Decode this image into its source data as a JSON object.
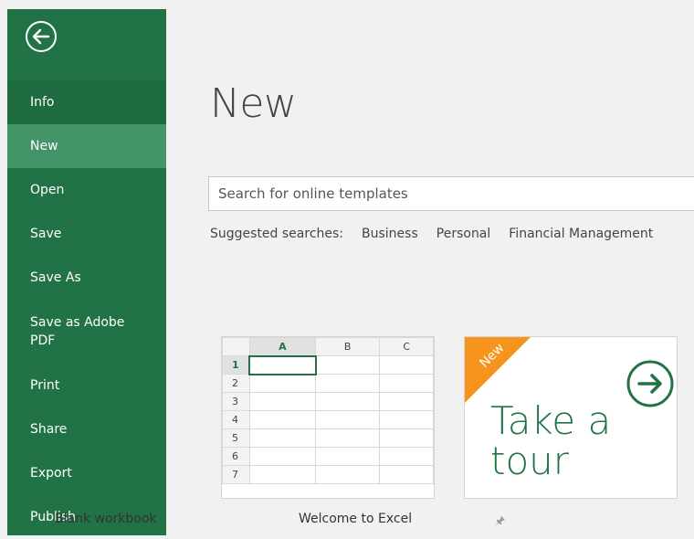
{
  "nav": {
    "items": [
      {
        "label": "Info"
      },
      {
        "label": "New"
      },
      {
        "label": "Open"
      },
      {
        "label": "Save"
      },
      {
        "label": "Save As"
      },
      {
        "label": "Save as Adobe PDF"
      },
      {
        "label": "Print"
      },
      {
        "label": "Share"
      },
      {
        "label": "Export"
      },
      {
        "label": "Publish"
      }
    ]
  },
  "main": {
    "title": "New",
    "search_placeholder": "Search for online templates",
    "suggested": {
      "label": "Suggested searches:",
      "items": [
        "Business",
        "Personal",
        "Financial Management"
      ]
    },
    "templates": [
      {
        "caption": "Blank workbook"
      },
      {
        "caption": "Welcome to Excel",
        "badge": "New",
        "tour_line1": "Take a",
        "tour_line2": "tour"
      }
    ],
    "grid": {
      "columns": [
        "A",
        "B",
        "C"
      ],
      "rows": [
        "1",
        "2",
        "3",
        "4",
        "5",
        "6",
        "7"
      ]
    }
  },
  "colors": {
    "accent": "#217346",
    "nav_active": "#439467",
    "nav_info": "#1d6b3f",
    "badge": "#f7941d"
  }
}
